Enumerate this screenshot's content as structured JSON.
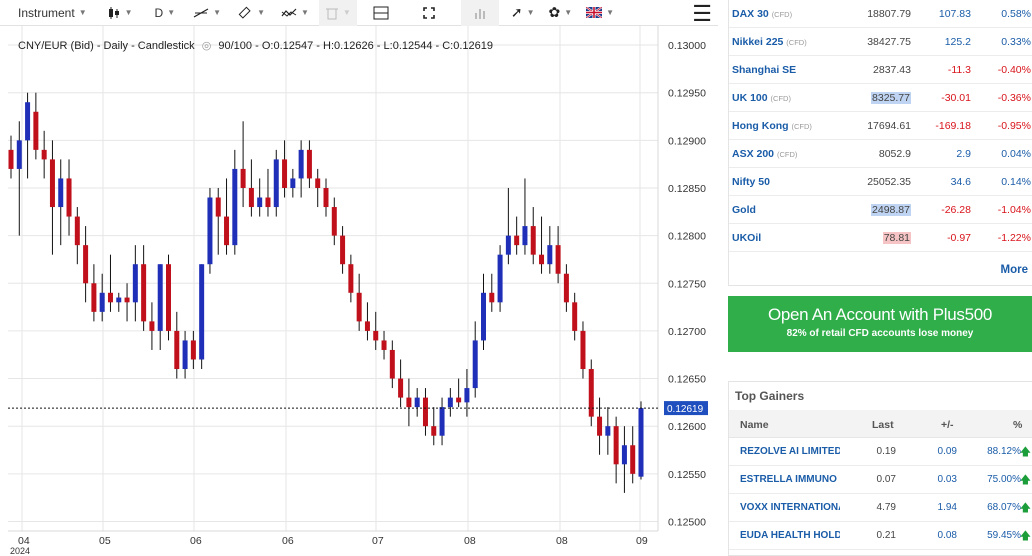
{
  "toolbar": {
    "instrument_label": "Instrument",
    "timeframe_label": "D",
    "items": [
      "candle-type",
      "timeframe",
      "line-tools",
      "drawing-tools",
      "indicators",
      "trash",
      "layout",
      "fullscreen",
      "volume",
      "arrow-tools",
      "settings",
      "language"
    ]
  },
  "chart_legend": {
    "text": "CNY/EUR (Bid) - Daily - Candlestick",
    "period": "90/100",
    "ohlc": "O:0.12547 - H:0.12626 - L:0.12544 - C:0.12619"
  },
  "chart_data": {
    "type": "candlestick",
    "title": "CNY/EUR (Bid) - Daily - Candlestick",
    "y_ticks": [
      "0.13000",
      "0.12950",
      "0.12900",
      "0.12850",
      "0.12800",
      "0.12750",
      "0.12700",
      "0.12650",
      "0.12600",
      "0.12550",
      "0.12500"
    ],
    "ylim": [
      0.1249,
      0.1302
    ],
    "x_ticks": [
      "04",
      "05",
      "06",
      "06",
      "07",
      "08",
      "08",
      "09"
    ],
    "x_year": "2024",
    "current_price": "0.12619",
    "colors": {
      "up": "#1f2fb8",
      "down": "#c0101b",
      "wick": "#111111",
      "price_tag": "#1f4fbf"
    },
    "candles": [
      [
        0.1289,
        0.12905,
        0.1286,
        0.1287
      ],
      [
        0.1287,
        0.1292,
        0.128,
        0.129
      ],
      [
        0.129,
        0.1295,
        0.1286,
        0.1294
      ],
      [
        0.1293,
        0.1295,
        0.1288,
        0.1289
      ],
      [
        0.1289,
        0.1291,
        0.1286,
        0.1288
      ],
      [
        0.1288,
        0.129,
        0.1278,
        0.1283
      ],
      [
        0.1283,
        0.1288,
        0.1279,
        0.1286
      ],
      [
        0.1286,
        0.1288,
        0.128,
        0.1282
      ],
      [
        0.1282,
        0.1283,
        0.1277,
        0.1279
      ],
      [
        0.1279,
        0.1281,
        0.1273,
        0.1275
      ],
      [
        0.1275,
        0.1277,
        0.1271,
        0.1272
      ],
      [
        0.1272,
        0.1276,
        0.1271,
        0.1274
      ],
      [
        0.1274,
        0.1278,
        0.1272,
        0.1273
      ],
      [
        0.1273,
        0.1274,
        0.1272,
        0.12735
      ],
      [
        0.12735,
        0.1275,
        0.1271,
        0.1273
      ],
      [
        0.1273,
        0.1279,
        0.1271,
        0.1277
      ],
      [
        0.1277,
        0.1279,
        0.127,
        0.1271
      ],
      [
        0.1271,
        0.1273,
        0.1268,
        0.127
      ],
      [
        0.127,
        0.1277,
        0.1268,
        0.1277
      ],
      [
        0.1277,
        0.1278,
        0.1269,
        0.127
      ],
      [
        0.127,
        0.1272,
        0.1265,
        0.1266
      ],
      [
        0.1266,
        0.127,
        0.1265,
        0.1269
      ],
      [
        0.1269,
        0.127,
        0.1266,
        0.1267
      ],
      [
        0.1267,
        0.1277,
        0.1266,
        0.1277
      ],
      [
        0.1277,
        0.1285,
        0.1276,
        0.1284
      ],
      [
        0.1284,
        0.1285,
        0.1278,
        0.1282
      ],
      [
        0.1282,
        0.1286,
        0.1278,
        0.1279
      ],
      [
        0.1279,
        0.1289,
        0.1278,
        0.1287
      ],
      [
        0.1287,
        0.1292,
        0.1283,
        0.1285
      ],
      [
        0.1285,
        0.1288,
        0.1282,
        0.1283
      ],
      [
        0.1283,
        0.1286,
        0.1282,
        0.1284
      ],
      [
        0.1284,
        0.1287,
        0.1282,
        0.1283
      ],
      [
        0.1283,
        0.1289,
        0.1282,
        0.1288
      ],
      [
        0.1288,
        0.129,
        0.1284,
        0.1285
      ],
      [
        0.1285,
        0.1287,
        0.1284,
        0.1286
      ],
      [
        0.1286,
        0.129,
        0.1284,
        0.1289
      ],
      [
        0.1289,
        0.129,
        0.1285,
        0.1286
      ],
      [
        0.1286,
        0.1287,
        0.1283,
        0.1285
      ],
      [
        0.1285,
        0.1286,
        0.1282,
        0.1283
      ],
      [
        0.1283,
        0.1284,
        0.1279,
        0.128
      ],
      [
        0.128,
        0.1281,
        0.1276,
        0.1277
      ],
      [
        0.1277,
        0.1278,
        0.1273,
        0.1274
      ],
      [
        0.1274,
        0.1276,
        0.127,
        0.1271
      ],
      [
        0.1271,
        0.1273,
        0.1269,
        0.127
      ],
      [
        0.127,
        0.1272,
        0.1268,
        0.1269
      ],
      [
        0.1269,
        0.127,
        0.1267,
        0.1268
      ],
      [
        0.1268,
        0.1269,
        0.1264,
        0.1265
      ],
      [
        0.1265,
        0.1267,
        0.1262,
        0.1263
      ],
      [
        0.1263,
        0.1265,
        0.126,
        0.1262
      ],
      [
        0.1262,
        0.1264,
        0.1261,
        0.1263
      ],
      [
        0.1263,
        0.1264,
        0.1259,
        0.126
      ],
      [
        0.126,
        0.1262,
        0.1258,
        0.1259
      ],
      [
        0.1259,
        0.1263,
        0.1258,
        0.1262
      ],
      [
        0.1262,
        0.1264,
        0.1261,
        0.1263
      ],
      [
        0.1263,
        0.1265,
        0.1262,
        0.12625
      ],
      [
        0.12625,
        0.1266,
        0.1261,
        0.1264
      ],
      [
        0.1264,
        0.1271,
        0.1263,
        0.1269
      ],
      [
        0.1269,
        0.1276,
        0.1268,
        0.1274
      ],
      [
        0.1274,
        0.1276,
        0.1272,
        0.1273
      ],
      [
        0.1273,
        0.1279,
        0.1272,
        0.1278
      ],
      [
        0.1278,
        0.1285,
        0.1277,
        0.128
      ],
      [
        0.128,
        0.1282,
        0.1278,
        0.1279
      ],
      [
        0.1279,
        0.1286,
        0.1278,
        0.1281
      ],
      [
        0.1281,
        0.1283,
        0.1277,
        0.1278
      ],
      [
        0.1278,
        0.1282,
        0.1276,
        0.1277
      ],
      [
        0.1277,
        0.1281,
        0.1276,
        0.1279
      ],
      [
        0.1279,
        0.1281,
        0.1275,
        0.1276
      ],
      [
        0.1276,
        0.1277,
        0.1272,
        0.1273
      ],
      [
        0.1273,
        0.1274,
        0.1269,
        0.127
      ],
      [
        0.127,
        0.1271,
        0.1265,
        0.1266
      ],
      [
        0.1266,
        0.1267,
        0.126,
        0.1261
      ],
      [
        0.1261,
        0.1263,
        0.1257,
        0.1259
      ],
      [
        0.1259,
        0.1262,
        0.1257,
        0.126
      ],
      [
        0.126,
        0.1261,
        0.1254,
        0.1256
      ],
      [
        0.1256,
        0.126,
        0.1253,
        0.1258
      ],
      [
        0.1258,
        0.126,
        0.1254,
        0.1255
      ],
      [
        0.12547,
        0.12626,
        0.12544,
        0.12619
      ]
    ]
  },
  "markets": [
    {
      "name": "DAX 30",
      "tag": "(CFD)",
      "last": "18807.79",
      "change": "107.83",
      "pct": "0.58%",
      "dir": "pos",
      "hl": ""
    },
    {
      "name": "Nikkei 225",
      "tag": "(CFD)",
      "last": "38427.75",
      "change": "125.2",
      "pct": "0.33%",
      "dir": "pos",
      "hl": ""
    },
    {
      "name": "Shanghai SE",
      "tag": "",
      "last": "2837.43",
      "change": "-11.3",
      "pct": "-0.40%",
      "dir": "neg",
      "hl": ""
    },
    {
      "name": "UK 100",
      "tag": "(CFD)",
      "last": "8325.77",
      "change": "-30.01",
      "pct": "-0.36%",
      "dir": "neg",
      "hl": "blue"
    },
    {
      "name": "Hong Kong",
      "tag": "(CFD)",
      "last": "17694.61",
      "change": "-169.18",
      "pct": "-0.95%",
      "dir": "neg",
      "hl": ""
    },
    {
      "name": "ASX 200",
      "tag": "(CFD)",
      "last": "8052.9",
      "change": "2.9",
      "pct": "0.04%",
      "dir": "pos",
      "hl": ""
    },
    {
      "name": "Nifty 50",
      "tag": "",
      "last": "25052.35",
      "change": "34.6",
      "pct": "0.14%",
      "dir": "pos",
      "hl": ""
    },
    {
      "name": "Gold",
      "tag": "",
      "last": "2498.87",
      "change": "-26.28",
      "pct": "-1.04%",
      "dir": "neg",
      "hl": "blue"
    },
    {
      "name": "UKOil",
      "tag": "",
      "last": "78.81",
      "change": "-0.97",
      "pct": "-1.22%",
      "dir": "neg",
      "hl": "red"
    }
  ],
  "more_label": "More",
  "promo": {
    "title": "Open An Account with Plus500",
    "disclaimer": "82% of retail CFD accounts lose money"
  },
  "gainers": {
    "title": "Top Gainers",
    "headers": {
      "name": "Name",
      "last": "Last",
      "change": "+/-",
      "pct": "%"
    },
    "rows": [
      {
        "name": "REZOLVE AI LIMITED",
        "last": "0.19",
        "change": "0.09",
        "pct": "88.12%"
      },
      {
        "name": "ESTRELLA IMMUNO",
        "last": "0.07",
        "change": "0.03",
        "pct": "75.00%"
      },
      {
        "name": "VOXX INTERNATIONAL",
        "last": "4.79",
        "change": "1.94",
        "pct": "68.07%"
      },
      {
        "name": "EUDA HEALTH HOLDINGS",
        "last": "0.21",
        "change": "0.08",
        "pct": "59.45%"
      }
    ]
  }
}
